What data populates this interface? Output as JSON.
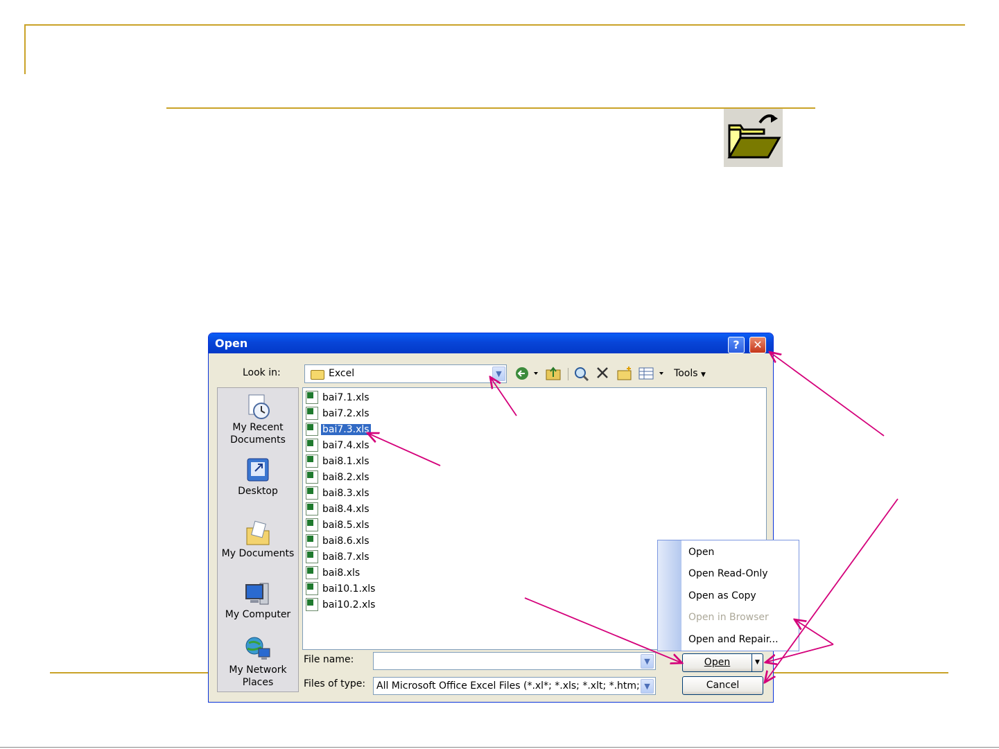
{
  "dialog": {
    "title": "Open",
    "help_glyph": "?",
    "close_glyph": "✕",
    "look_in_label": "Look in:",
    "look_in_value": "Excel",
    "toolbar": {
      "back_icon": "back-arrow-icon",
      "up_folder_icon": "up-one-level-icon",
      "search_web_icon": "search-web-icon",
      "delete_icon": "delete-icon",
      "new_folder_icon": "new-folder-icon",
      "views_icon": "views-icon",
      "tools_label": "Tools"
    },
    "places": [
      {
        "label": "My Recent Documents",
        "icon": "recent-documents-icon"
      },
      {
        "label": "Desktop",
        "icon": "desktop-icon"
      },
      {
        "label": "My Documents",
        "icon": "my-documents-icon"
      },
      {
        "label": "My Computer",
        "icon": "my-computer-icon"
      },
      {
        "label": "My Network Places",
        "icon": "network-places-icon"
      }
    ],
    "files": [
      "bai7.1.xls",
      "bai7.2.xls",
      "bai7.3.xls",
      "bai7.4.xls",
      "bai8.1.xls",
      "bai8.2.xls",
      "bai8.3.xls",
      "bai8.4.xls",
      "bai8.5.xls",
      "bai8.6.xls",
      "bai8.7.xls",
      "bai8.xls",
      "bai10.1.xls",
      "bai10.2.xls"
    ],
    "selected_file": "bai7.3.xls",
    "file_name_label": "File name:",
    "file_name_value": "",
    "files_of_type_label": "Files of type:",
    "files_of_type_value": "All Microsoft Office Excel Files (*.xl*; *.xls; *.xlt; *.htm; *",
    "open_button": "Open",
    "cancel_button": "Cancel"
  },
  "open_menu": [
    {
      "label": "Open",
      "enabled": true
    },
    {
      "label": "Open Read-Only",
      "enabled": true
    },
    {
      "label": "Open as Copy",
      "enabled": true
    },
    {
      "label": "Open in Browser",
      "enabled": false
    },
    {
      "label": "Open and Repair...",
      "enabled": true
    }
  ],
  "colors": {
    "titlebar": "#0845d8",
    "selection": "#316ac5",
    "annotation_arrow": "#d4007a",
    "slide_rule": "#c9a227"
  },
  "decor": {
    "toolbar_open_icon": "open-folder-icon"
  }
}
